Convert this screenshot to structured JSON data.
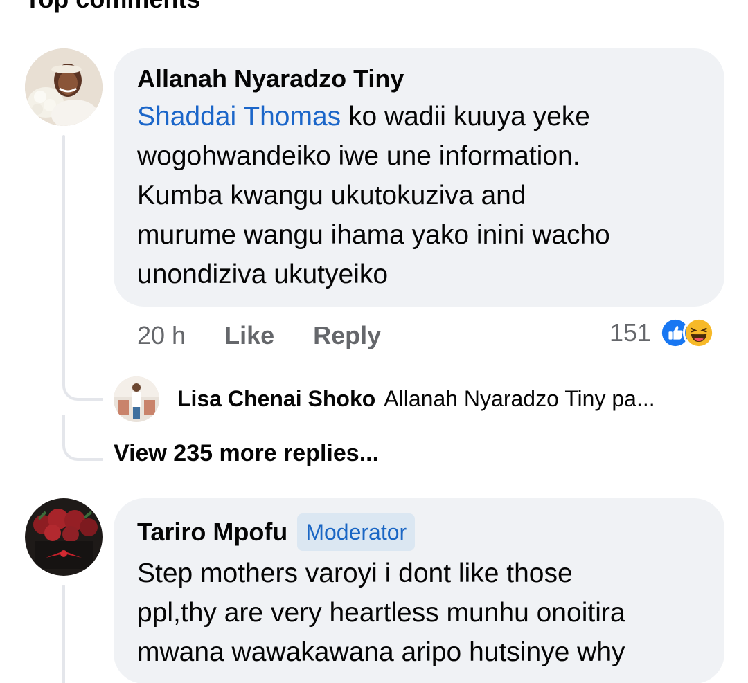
{
  "section": {
    "title": "Top comments"
  },
  "comments": [
    {
      "author": "Allanah Nyaradzo Tiny",
      "mention": "Shaddai Thomas",
      "text_line1": " ko wadii kuuya yeke",
      "text_line2": "wogohwandeiko iwe une information.",
      "text_line3": "Kumba kwangu ukutokuziva and",
      "text_line4": "murume wangu ihama yako inini wacho",
      "text_line5": "unondiziva ukutyeiko",
      "time": "20 h",
      "like_label": "Like",
      "reply_label": "Reply",
      "reaction_count": "151",
      "reactions": [
        "like-icon",
        "haha-icon"
      ],
      "reply_preview": {
        "author": "Lisa Chenai Shoko",
        "snippet": "Allanah Nyaradzo Tiny pa..."
      },
      "view_more": "View 235 more replies..."
    },
    {
      "author": "Tariro Mpofu",
      "badge": "Moderator",
      "text_line1": "Step mothers varoyi i dont like those",
      "text_line2": "ppl,thy are very heartless munhu onoitira",
      "text_line3": "mwana wawakawana aripo hutsinye why"
    }
  ],
  "colors": {
    "bubble": "#f0f2f5",
    "link": "#1b66c9",
    "muted": "#65676b",
    "thread": "#e4e6eb",
    "badge_bg": "#dbe7f2",
    "like_blue": "#1877f2",
    "haha_yellow": "#f7b928"
  }
}
